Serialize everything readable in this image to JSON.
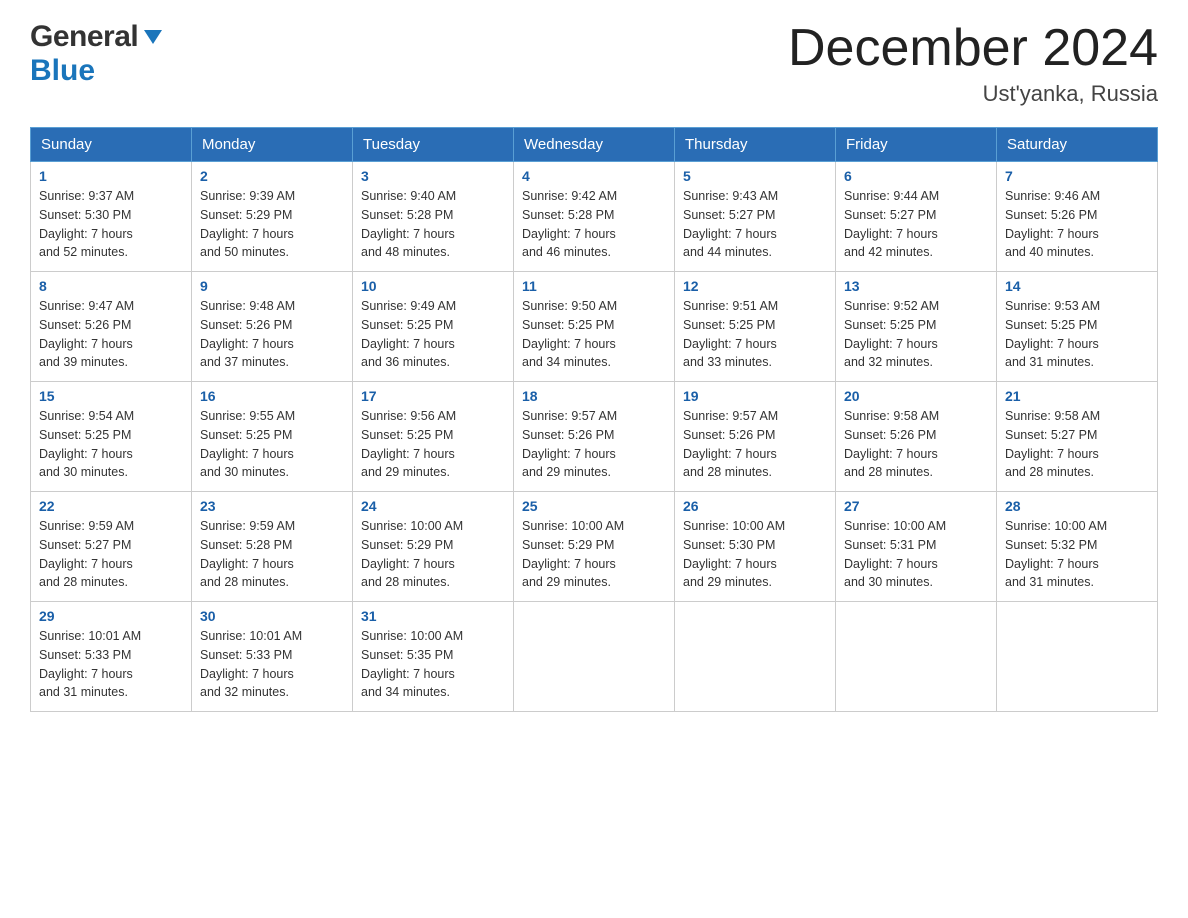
{
  "header": {
    "logo_general": "General",
    "logo_blue": "Blue",
    "month": "December 2024",
    "location": "Ust'yanka, Russia"
  },
  "days_of_week": [
    "Sunday",
    "Monday",
    "Tuesday",
    "Wednesday",
    "Thursday",
    "Friday",
    "Saturday"
  ],
  "weeks": [
    [
      {
        "day": "1",
        "sunrise": "9:37 AM",
        "sunset": "5:30 PM",
        "daylight": "7 hours and 52 minutes."
      },
      {
        "day": "2",
        "sunrise": "9:39 AM",
        "sunset": "5:29 PM",
        "daylight": "7 hours and 50 minutes."
      },
      {
        "day": "3",
        "sunrise": "9:40 AM",
        "sunset": "5:28 PM",
        "daylight": "7 hours and 48 minutes."
      },
      {
        "day": "4",
        "sunrise": "9:42 AM",
        "sunset": "5:28 PM",
        "daylight": "7 hours and 46 minutes."
      },
      {
        "day": "5",
        "sunrise": "9:43 AM",
        "sunset": "5:27 PM",
        "daylight": "7 hours and 44 minutes."
      },
      {
        "day": "6",
        "sunrise": "9:44 AM",
        "sunset": "5:27 PM",
        "daylight": "7 hours and 42 minutes."
      },
      {
        "day": "7",
        "sunrise": "9:46 AM",
        "sunset": "5:26 PM",
        "daylight": "7 hours and 40 minutes."
      }
    ],
    [
      {
        "day": "8",
        "sunrise": "9:47 AM",
        "sunset": "5:26 PM",
        "daylight": "7 hours and 39 minutes."
      },
      {
        "day": "9",
        "sunrise": "9:48 AM",
        "sunset": "5:26 PM",
        "daylight": "7 hours and 37 minutes."
      },
      {
        "day": "10",
        "sunrise": "9:49 AM",
        "sunset": "5:25 PM",
        "daylight": "7 hours and 36 minutes."
      },
      {
        "day": "11",
        "sunrise": "9:50 AM",
        "sunset": "5:25 PM",
        "daylight": "7 hours and 34 minutes."
      },
      {
        "day": "12",
        "sunrise": "9:51 AM",
        "sunset": "5:25 PM",
        "daylight": "7 hours and 33 minutes."
      },
      {
        "day": "13",
        "sunrise": "9:52 AM",
        "sunset": "5:25 PM",
        "daylight": "7 hours and 32 minutes."
      },
      {
        "day": "14",
        "sunrise": "9:53 AM",
        "sunset": "5:25 PM",
        "daylight": "7 hours and 31 minutes."
      }
    ],
    [
      {
        "day": "15",
        "sunrise": "9:54 AM",
        "sunset": "5:25 PM",
        "daylight": "7 hours and 30 minutes."
      },
      {
        "day": "16",
        "sunrise": "9:55 AM",
        "sunset": "5:25 PM",
        "daylight": "7 hours and 30 minutes."
      },
      {
        "day": "17",
        "sunrise": "9:56 AM",
        "sunset": "5:25 PM",
        "daylight": "7 hours and 29 minutes."
      },
      {
        "day": "18",
        "sunrise": "9:57 AM",
        "sunset": "5:26 PM",
        "daylight": "7 hours and 29 minutes."
      },
      {
        "day": "19",
        "sunrise": "9:57 AM",
        "sunset": "5:26 PM",
        "daylight": "7 hours and 28 minutes."
      },
      {
        "day": "20",
        "sunrise": "9:58 AM",
        "sunset": "5:26 PM",
        "daylight": "7 hours and 28 minutes."
      },
      {
        "day": "21",
        "sunrise": "9:58 AM",
        "sunset": "5:27 PM",
        "daylight": "7 hours and 28 minutes."
      }
    ],
    [
      {
        "day": "22",
        "sunrise": "9:59 AM",
        "sunset": "5:27 PM",
        "daylight": "7 hours and 28 minutes."
      },
      {
        "day": "23",
        "sunrise": "9:59 AM",
        "sunset": "5:28 PM",
        "daylight": "7 hours and 28 minutes."
      },
      {
        "day": "24",
        "sunrise": "10:00 AM",
        "sunset": "5:29 PM",
        "daylight": "7 hours and 28 minutes."
      },
      {
        "day": "25",
        "sunrise": "10:00 AM",
        "sunset": "5:29 PM",
        "daylight": "7 hours and 29 minutes."
      },
      {
        "day": "26",
        "sunrise": "10:00 AM",
        "sunset": "5:30 PM",
        "daylight": "7 hours and 29 minutes."
      },
      {
        "day": "27",
        "sunrise": "10:00 AM",
        "sunset": "5:31 PM",
        "daylight": "7 hours and 30 minutes."
      },
      {
        "day": "28",
        "sunrise": "10:00 AM",
        "sunset": "5:32 PM",
        "daylight": "7 hours and 31 minutes."
      }
    ],
    [
      {
        "day": "29",
        "sunrise": "10:01 AM",
        "sunset": "5:33 PM",
        "daylight": "7 hours and 31 minutes."
      },
      {
        "day": "30",
        "sunrise": "10:01 AM",
        "sunset": "5:33 PM",
        "daylight": "7 hours and 32 minutes."
      },
      {
        "day": "31",
        "sunrise": "10:00 AM",
        "sunset": "5:35 PM",
        "daylight": "7 hours and 34 minutes."
      },
      null,
      null,
      null,
      null
    ]
  ],
  "labels": {
    "sunrise": "Sunrise:",
    "sunset": "Sunset:",
    "daylight": "Daylight:"
  }
}
